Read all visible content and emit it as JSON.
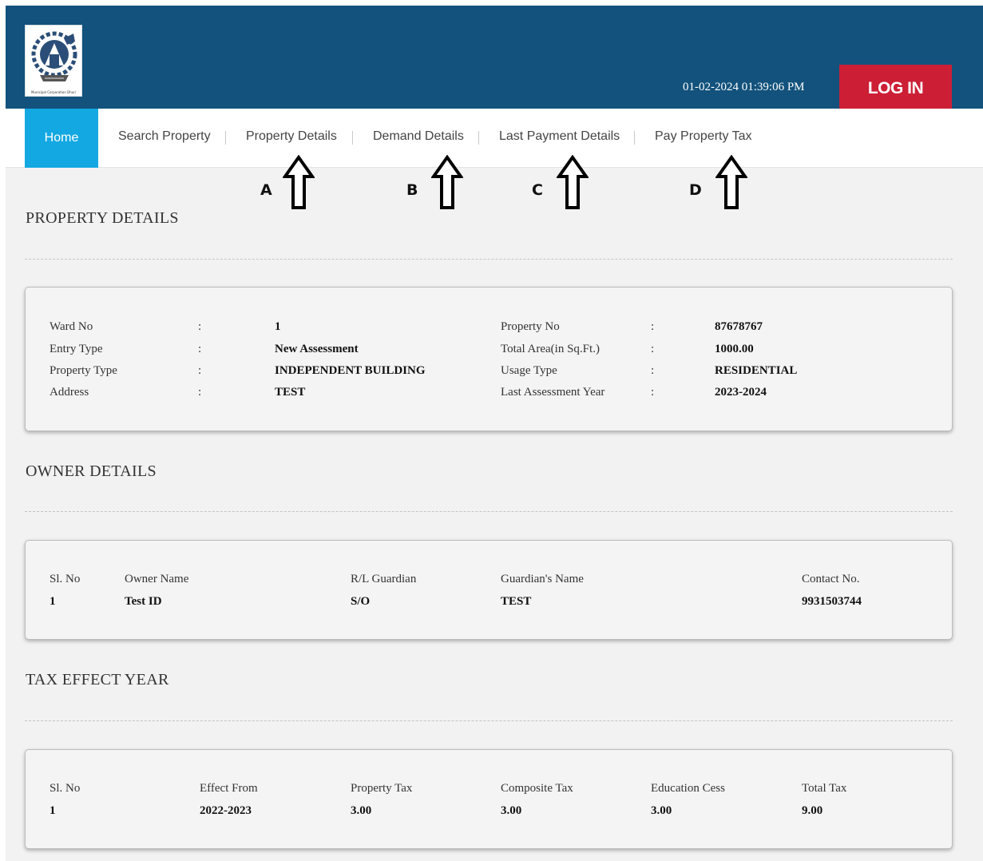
{
  "header": {
    "logo_caption": "Municipal Corporation Dhuri",
    "datetime": "01-02-2024 01:39:06 PM",
    "login_label": "LOG IN"
  },
  "nav": {
    "items": [
      "Home",
      "Search Property",
      "Property Details",
      "Demand Details",
      "Last Payment Details",
      "Pay Property Tax"
    ]
  },
  "annotations": [
    "A",
    "B",
    "C",
    "D"
  ],
  "property_details": {
    "title": "PROPERTY DETAILS",
    "separator": ":",
    "left": [
      {
        "label": "Ward No",
        "value": "1"
      },
      {
        "label": "Entry Type",
        "value": "New Assessment"
      },
      {
        "label": "Property Type",
        "value": "INDEPENDENT BUILDING"
      },
      {
        "label": "Address",
        "value": "TEST"
      }
    ],
    "right": [
      {
        "label": "Property No",
        "value": "87678767"
      },
      {
        "label": "Total Area(in Sq.Ft.)",
        "value": "1000.00"
      },
      {
        "label": "Usage Type",
        "value": "RESIDENTIAL"
      },
      {
        "label": "Last Assessment Year",
        "value": "2023-2024"
      }
    ]
  },
  "owner_details": {
    "title": "OWNER DETAILS",
    "columns": [
      "Sl. No",
      "Owner Name",
      "R/L Guardian",
      "Guardian's Name",
      "Contact No."
    ],
    "rows": [
      [
        "1",
        "Test ID",
        "S/O",
        "TEST",
        "9931503744"
      ]
    ]
  },
  "tax_effect": {
    "title": "TAX EFFECT YEAR",
    "columns": [
      "Sl. No",
      "Effect From",
      "Property Tax",
      "Composite Tax",
      "Education Cess",
      "Total Tax"
    ],
    "rows": [
      [
        "1",
        "2022-2023",
        "3.00",
        "3.00",
        "3.00",
        "9.00"
      ]
    ]
  },
  "colors": {
    "header_bg": "#12527c",
    "login_bg": "#cc1f36",
    "home_tab_bg": "#14a8e2",
    "content_bg": "#f2f2f2"
  },
  "icons": {
    "logo": "municipal-emblem-icon",
    "annotation_arrow": "arrow-up-outline-icon"
  }
}
